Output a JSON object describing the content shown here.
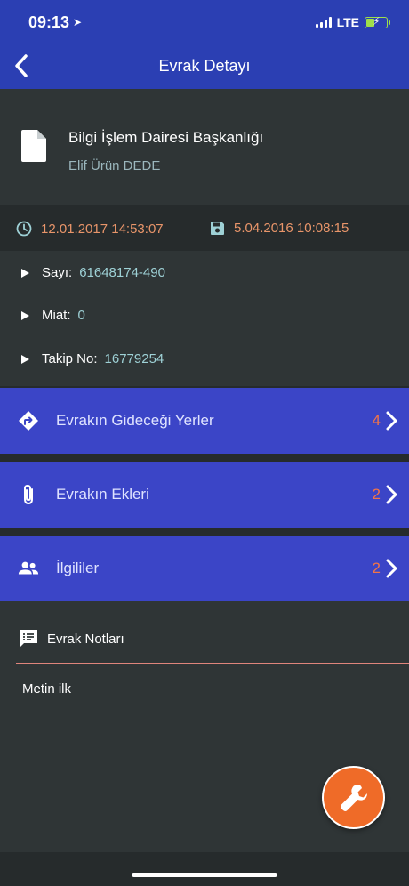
{
  "status_bar": {
    "time": "09:13",
    "network": "LTE"
  },
  "header": {
    "title": "Evrak Detayı"
  },
  "document": {
    "title": "Bilgi İşlem Dairesi Başkanlığı",
    "owner": "Elif Ürün DEDE"
  },
  "dates": {
    "created": "12.01.2017 14:53:07",
    "saved": "5.04.2016 10:08:15"
  },
  "info": [
    {
      "label": "Sayı:",
      "value": "61648174-490"
    },
    {
      "label": "Miat:",
      "value": "0"
    },
    {
      "label": "Takip No:",
      "value": "16779254"
    }
  ],
  "nav": [
    {
      "label": "Evrakın Gideceği Yerler",
      "count": "4",
      "icon": "directions-icon"
    },
    {
      "label": "Evrakın Ekleri",
      "count": "2",
      "icon": "paperclip-icon"
    },
    {
      "label": "İlgililer",
      "count": "2",
      "icon": "people-icon"
    }
  ],
  "notes": {
    "title": "Evrak Notları",
    "text": "Metin ilk"
  },
  "colors": {
    "header": "#2b3fb3",
    "nav_row": "#3b45c7",
    "accent": "#f07448",
    "fab": "#ef6b28",
    "background": "#2f3536"
  }
}
